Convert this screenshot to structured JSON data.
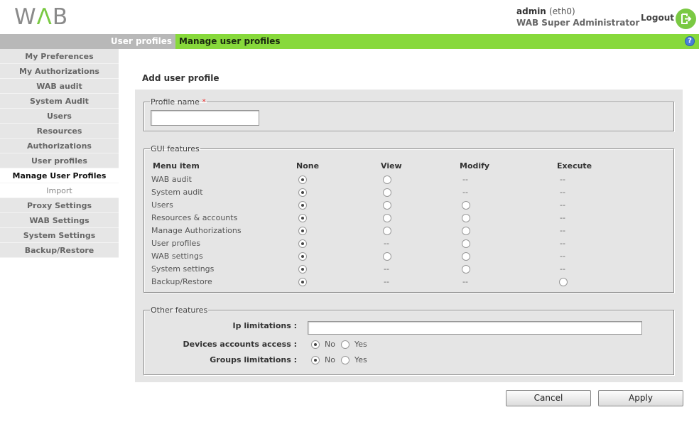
{
  "header": {
    "logo": "WAB",
    "user": "admin",
    "interface": "(eth0)",
    "role": "WAB Super Administrator",
    "logout": "Logout"
  },
  "breadcrumb": {
    "parent": "User profiles",
    "current": "Manage user profiles",
    "help": "?"
  },
  "sidebar": {
    "items": [
      {
        "label": "My Preferences"
      },
      {
        "label": "My Authorizations"
      },
      {
        "label": "WAB audit"
      },
      {
        "label": "System Audit"
      },
      {
        "label": "Users"
      },
      {
        "label": "Resources"
      },
      {
        "label": "Authorizations"
      },
      {
        "label": "User profiles"
      },
      {
        "label": "Manage User Profiles"
      },
      {
        "label": "Import"
      },
      {
        "label": "Proxy Settings"
      },
      {
        "label": "WAB Settings"
      },
      {
        "label": "System Settings"
      },
      {
        "label": "Backup/Restore"
      }
    ]
  },
  "page": {
    "title": "Add user profile"
  },
  "profile": {
    "legend": "Profile name",
    "required": "*",
    "value": ""
  },
  "gui": {
    "legend": "GUI features",
    "columns": [
      "Menu item",
      "None",
      "View",
      "Modify",
      "Execute"
    ],
    "rows": [
      {
        "label": "WAB audit",
        "none": "radio-checked",
        "view": "radio",
        "modify": "--",
        "execute": "--"
      },
      {
        "label": "System audit",
        "none": "radio-checked",
        "view": "radio",
        "modify": "--",
        "execute": "--"
      },
      {
        "label": "Users",
        "none": "radio-checked",
        "view": "radio",
        "modify": "radio",
        "execute": "--"
      },
      {
        "label": "Resources & accounts",
        "none": "radio-checked",
        "view": "radio",
        "modify": "radio",
        "execute": "--"
      },
      {
        "label": "Manage Authorizations",
        "none": "radio-checked",
        "view": "radio",
        "modify": "radio",
        "execute": "--"
      },
      {
        "label": "User profiles",
        "none": "radio-checked",
        "view": "--",
        "modify": "radio",
        "execute": "--"
      },
      {
        "label": "WAB settings",
        "none": "radio-checked",
        "view": "radio",
        "modify": "radio",
        "execute": "--"
      },
      {
        "label": "System settings",
        "none": "radio-checked",
        "view": "--",
        "modify": "radio",
        "execute": "--"
      },
      {
        "label": "Backup/Restore",
        "none": "radio-checked",
        "view": "--",
        "modify": "--",
        "execute": "radio"
      }
    ]
  },
  "other": {
    "legend": "Other features",
    "ip_label": "Ip limitations :",
    "ip_value": "",
    "devices_label": "Devices accounts access :",
    "groups_label": "Groups limitations :",
    "no": "No",
    "yes": "Yes",
    "devices_selected": "No",
    "groups_selected": "No"
  },
  "actions": {
    "cancel": "Cancel",
    "apply": "Apply"
  }
}
